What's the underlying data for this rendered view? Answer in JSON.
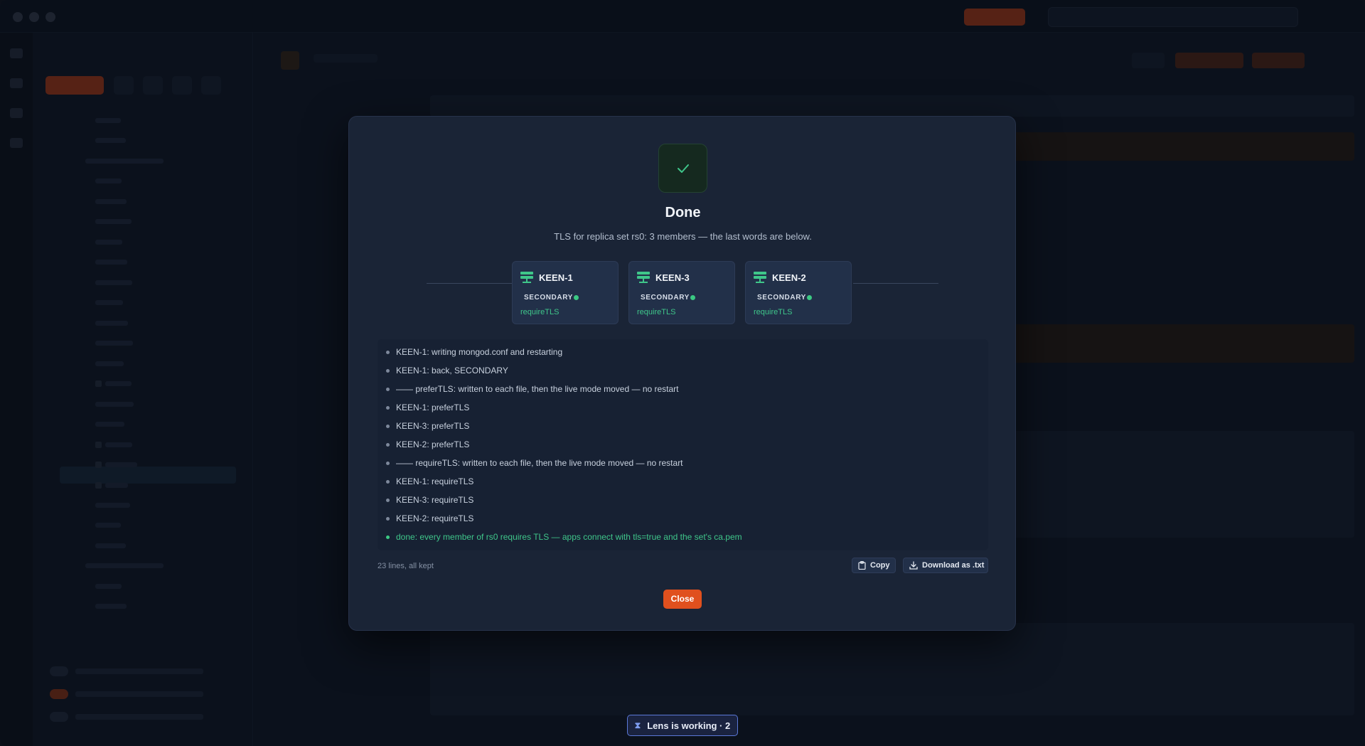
{
  "modal": {
    "title": "Done",
    "subtitle": "TLS for replica set rs0: 3 members — the last words are below.",
    "members": [
      {
        "name": "KEEN-1",
        "role": "SECONDARY",
        "mode": "requireTLS"
      },
      {
        "name": "KEEN-3",
        "role": "SECONDARY",
        "mode": "requireTLS"
      },
      {
        "name": "KEEN-2",
        "role": "SECONDARY",
        "mode": "requireTLS"
      }
    ],
    "log_lines": [
      {
        "text": "KEEN-1: writing mongod.conf and restarting",
        "status": "info"
      },
      {
        "text": "KEEN-1: back, SECONDARY",
        "status": "info"
      },
      {
        "text": "—— preferTLS: written to each file, then the live mode moved — no restart",
        "status": "info"
      },
      {
        "text": "KEEN-1: preferTLS",
        "status": "info"
      },
      {
        "text": "KEEN-3: preferTLS",
        "status": "info"
      },
      {
        "text": "KEEN-2: preferTLS",
        "status": "info"
      },
      {
        "text": "—— requireTLS: written to each file, then the live mode moved — no restart",
        "status": "info"
      },
      {
        "text": "KEEN-1: requireTLS",
        "status": "info"
      },
      {
        "text": "KEEN-3: requireTLS",
        "status": "info"
      },
      {
        "text": "KEEN-2: requireTLS",
        "status": "info"
      },
      {
        "text": "done: every member of rs0 requires TLS — apps connect with tls=true and the set's ca.pem",
        "status": "success"
      }
    ],
    "line_count": "23 lines, all kept",
    "copy_label": "Copy",
    "download_label": "Download as .txt",
    "close_label": "Close"
  },
  "toast": {
    "label": "Lens is working · 2"
  },
  "colors": {
    "accent": "#e0501e",
    "success": "#3fc68a",
    "toast_border": "#5b78d8"
  }
}
